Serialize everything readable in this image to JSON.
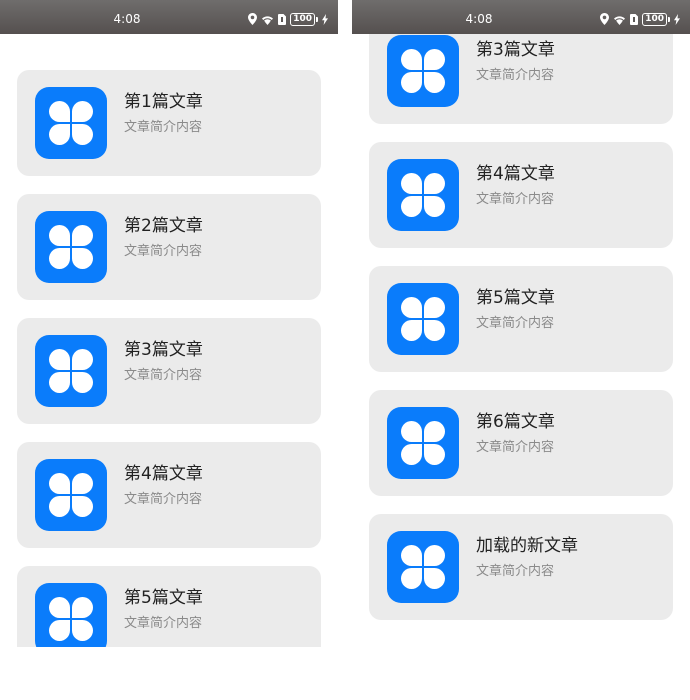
{
  "status_bar": {
    "time": "4:08",
    "battery": "100",
    "icons": [
      "location-icon",
      "wifi-icon",
      "sim-icon",
      "battery-icon",
      "charging-icon"
    ]
  },
  "theme": {
    "card_bg": "#ebebeb",
    "thumb_bg": "#0a7cfb",
    "title_color": "#222222",
    "summary_color": "#8a8a8a"
  },
  "screens": [
    {
      "articles": [
        {
          "title": "第1篇文章",
          "summary": "文章简介内容"
        },
        {
          "title": "第2篇文章",
          "summary": "文章简介内容"
        },
        {
          "title": "第3篇文章",
          "summary": "文章简介内容"
        },
        {
          "title": "第4篇文章",
          "summary": "文章简介内容"
        },
        {
          "title": "第5篇文章",
          "summary": "文章简介内容"
        }
      ]
    },
    {
      "articles": [
        {
          "title": "第3篇文章",
          "summary": "文章简介内容"
        },
        {
          "title": "第4篇文章",
          "summary": "文章简介内容"
        },
        {
          "title": "第5篇文章",
          "summary": "文章简介内容"
        },
        {
          "title": "第6篇文章",
          "summary": "文章简介内容"
        },
        {
          "title": "加载的新文章",
          "summary": "文章简介内容"
        }
      ]
    }
  ]
}
